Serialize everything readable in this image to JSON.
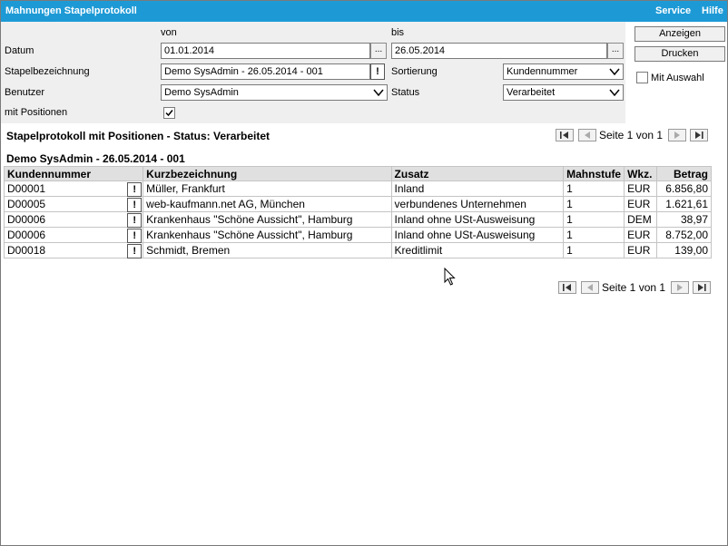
{
  "window": {
    "title": "Mahnungen Stapelprotokoll",
    "menu": [
      "Service",
      "Hilfe"
    ]
  },
  "filter": {
    "von_label": "von",
    "bis_label": "bis",
    "datum_label": "Datum",
    "datum_von": "01.01.2014",
    "datum_bis": "26.05.2014",
    "ellipsis": "...",
    "stapel_label": "Stapelbezeichnung",
    "stapel_value": "Demo SysAdmin - 26.05.2014 - 001",
    "bang": "!",
    "sort_label": "Sortierung",
    "sort_value": "Kundennummer",
    "benutzer_label": "Benutzer",
    "benutzer_value": "Demo SysAdmin",
    "status_label": "Status",
    "status_value": "Verarbeitet",
    "positionen_label": "mit Positionen",
    "positionen_checked": true
  },
  "actions": {
    "anzeigen": "Anzeigen",
    "drucken": "Drucken",
    "mit_auswahl_label": "Mit Auswahl",
    "mit_auswahl_checked": false
  },
  "report": {
    "heading": "Stapelprotokoll mit Positionen - Status: Verarbeitet",
    "group_title": "Demo SysAdmin - 26.05.2014 - 001",
    "page_text": "Seite 1 von 1"
  },
  "table": {
    "columns": [
      "Kundennummer",
      "Kurzbezeichnung",
      "Zusatz",
      "Mahnstufe",
      "Wkz.",
      "Betrag"
    ],
    "rows": [
      [
        "D00001",
        "Müller, Frankfurt",
        "Inland",
        "1",
        "EUR",
        "6.856,80"
      ],
      [
        "D00005",
        "web-kaufmann.net AG, München",
        "verbundenes Unternehmen",
        "1",
        "EUR",
        "1.621,61"
      ],
      [
        "D00006",
        "Krankenhaus \"Schöne Aussicht\", Hamburg",
        "Inland ohne USt-Ausweisung",
        "1",
        "DEM",
        "38,97"
      ],
      [
        "D00006",
        "Krankenhaus \"Schöne Aussicht\", Hamburg",
        "Inland ohne USt-Ausweisung",
        "1",
        "EUR",
        "8.752,00"
      ],
      [
        "D00018",
        "Schmidt, Bremen",
        "Kreditlimit",
        "1",
        "EUR",
        "139,00"
      ]
    ]
  },
  "icons": {
    "first": "first-page-icon",
    "prev": "previous-page-icon",
    "next": "next-page-icon",
    "last": "last-page-icon",
    "chevron": "chevron-down-icon",
    "check": "check-icon",
    "cursor": "mouse-cursor-icon"
  },
  "colors": {
    "titlebar": "#1d9ad6",
    "filter_bg": "#efefef",
    "header_bg": "#e0e0e0"
  }
}
